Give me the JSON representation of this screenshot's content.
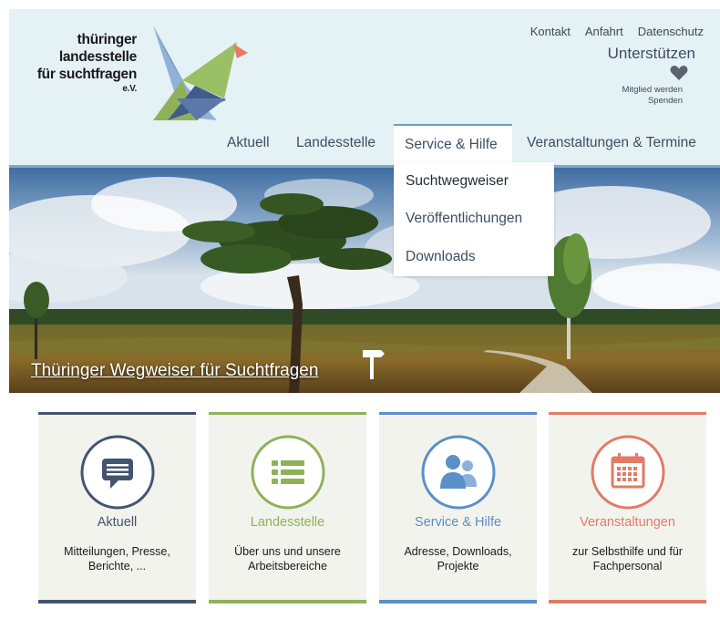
{
  "logo": {
    "line1": "thüringer",
    "line2": "landesstelle",
    "line3": "für suchtfragen",
    "line4": "e.V."
  },
  "top_links": [
    "Kontakt",
    "Anfahrt",
    "Datenschutz"
  ],
  "support": {
    "label": "Unterstützen",
    "sub1": "Mitglied werden",
    "sub2": "Spenden"
  },
  "nav": {
    "aktuell": "Aktuell",
    "landesstelle": "Landesstelle",
    "service": "Service & Hilfe",
    "events": "Veranstaltungen & Termine"
  },
  "dropdown": [
    "Suchtwegweiser",
    "Veröffentlichungen",
    "Downloads"
  ],
  "hero": {
    "caption": "Thüringer Wegweiser für Suchtfragen"
  },
  "cards": [
    {
      "title": "Aktuell",
      "desc": "Mitteilungen, Presse, Berichte, ...",
      "color": "#44546e",
      "icon": "speech-bubble-icon"
    },
    {
      "title": "Landesstelle",
      "desc": "Über uns und unsere Arbeitsbereiche",
      "color": "#8fb15a",
      "icon": "list-icon"
    },
    {
      "title": "Service & Hilfe",
      "desc": "Adresse, Downloads, Projekte",
      "color": "#5b8fc7",
      "icon": "people-icon"
    },
    {
      "title": "Veranstaltungen",
      "desc": "zur Selbsthilfe und für Fachpersonal",
      "color": "#e07b66",
      "icon": "calendar-icon"
    }
  ]
}
